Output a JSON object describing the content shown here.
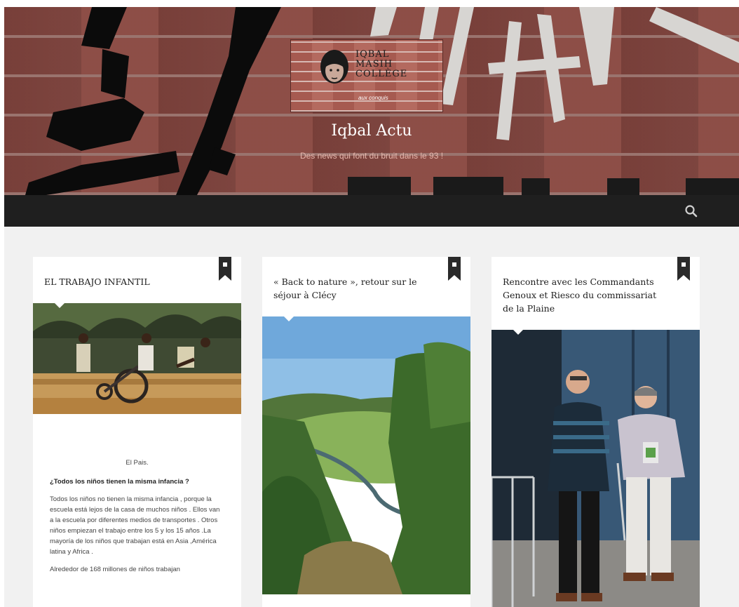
{
  "site": {
    "title": "Iqbal Actu",
    "description": "Des news qui font du bruit dans le 93 !",
    "logo_lines": [
      "IQBAL",
      "MASIH",
      "COLLÈGE"
    ],
    "logo_sub": "aux conquis"
  },
  "navbar": {
    "search_icon": "search-icon"
  },
  "posts": [
    {
      "title": "EL TRABAJO INFANTIL",
      "image": "children-pushing-cart-photo",
      "excerpt": {
        "source": "El Pais.",
        "question": "¿Todos los niños tienen la misma infancia ?",
        "paragraph1": "Todos los niños no tienen la misma infancia , porque la escuela está lejos de la casa de muchos niños . Ellos van a la escuela por diferentes medios de transportes . Otros niños empiezan el trabajo entre los 5 y los 15 años .La mayoría de los niños que trabajan está en Asia ,América latina y Africa .",
        "paragraph2": "Alrededor de 168 millones de niños trabajan"
      }
    },
    {
      "title": "« Back to nature », retour sur le séjour à Clécy",
      "image": "valley-landscape-photo"
    },
    {
      "title": "Rencontre avec les Commandants Genoux et Riesco du commissariat de la Plaine",
      "image": "two-men-photo"
    }
  ],
  "colors": {
    "navbar": "#1f1f1f",
    "background": "#f1f1f1",
    "card": "#ffffff",
    "bookmark": "#2a2a2a"
  }
}
